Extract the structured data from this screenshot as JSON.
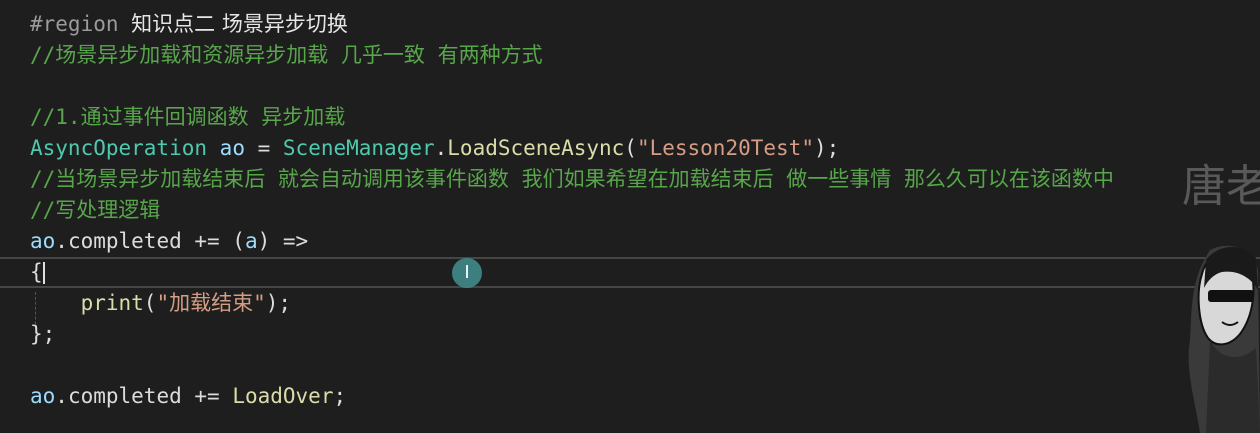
{
  "editor": {
    "region_keyword": "#region",
    "region_title": "知识点二 场景异步切换",
    "comment_1": "//场景异步加载和资源异步加载 几乎一致 有两种方式",
    "comment_2": "//1.通过事件回调函数 异步加载",
    "line_load": {
      "type": "AsyncOperation",
      "var": "ao",
      "op": " = ",
      "class": "SceneManager",
      "dot": ".",
      "method": "LoadSceneAsync",
      "open": "(",
      "arg": "\"Lesson20Test\"",
      "close": ");"
    },
    "comment_3": "//当场景异步加载结束后 就会自动调用该事件函数 我们如果希望在加载结束后 做一些事情 那么久可以在该函数中",
    "comment_4": "//写处理逻辑",
    "line_completed_lambda": {
      "var": "ao",
      "member": ".completed",
      "op": " += (",
      "param": "a",
      "arrow": ") =>"
    },
    "brace_open": "{",
    "line_print": {
      "method": "print",
      "open": "(",
      "arg": "\"加载结束\"",
      "close": ");"
    },
    "brace_close": "};",
    "line_completed_method": {
      "var": "ao",
      "member": ".completed",
      "op": " += ",
      "handler": "LoadOver",
      "end": ";"
    }
  },
  "overlay": {
    "watermark_text": "唐老",
    "cursor_icon": "i-beam-icon"
  }
}
